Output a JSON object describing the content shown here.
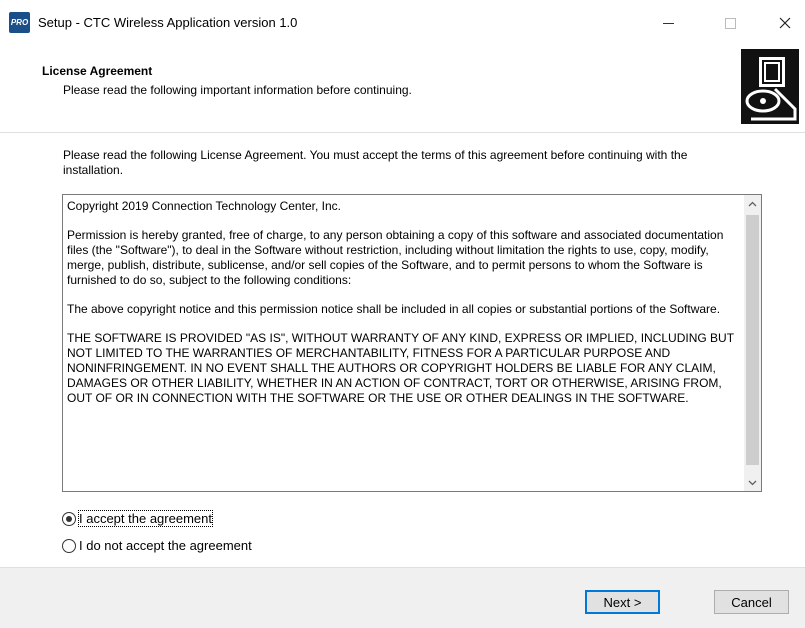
{
  "window": {
    "title": "Setup - CTC Wireless Application version 1.0",
    "icon": "setup-app-icon",
    "icon_text": "PRO",
    "controls": {
      "minimize": "—",
      "close": "✕"
    }
  },
  "header": {
    "title": "License Agreement",
    "subtitle": "Please read the following important information before continuing."
  },
  "instruction": "Please read the following License Agreement. You must accept the terms of this agreement before continuing with the installation.",
  "license": {
    "paragraphs": [
      "Copyright 2019 Connection Technology Center, Inc.",
      "Permission is hereby granted, free of charge, to any person obtaining a copy of this software and associated documentation files (the \"Software\"), to deal in the Software without restriction, including without limitation the rights to use, copy, modify, merge, publish, distribute, sublicense, and/or sell copies of the Software, and to permit persons to whom the Software is furnished to do so, subject to the following conditions:",
      "The above copyright notice and this permission notice shall be included in all copies or substantial portions of the Software.",
      "THE SOFTWARE IS PROVIDED \"AS IS\", WITHOUT WARRANTY OF ANY KIND, EXPRESS OR IMPLIED, INCLUDING BUT NOT LIMITED TO THE WARRANTIES OF MERCHANTABILITY, FITNESS FOR A PARTICULAR PURPOSE AND NONINFRINGEMENT. IN NO EVENT SHALL THE AUTHORS OR COPYRIGHT HOLDERS BE LIABLE FOR ANY CLAIM, DAMAGES OR OTHER LIABILITY, WHETHER IN AN ACTION OF CONTRACT, TORT OR OTHERWISE, ARISING FROM, OUT OF OR IN CONNECTION WITH THE SOFTWARE OR THE USE OR OTHER DEALINGS IN THE SOFTWARE."
    ]
  },
  "options": {
    "accept": {
      "label": "I accept the agreement",
      "selected": true
    },
    "decline": {
      "label": "I do not accept the agreement",
      "selected": false
    }
  },
  "buttons": {
    "next": "Next >",
    "cancel": "Cancel"
  },
  "colors": {
    "accent": "#0078d7",
    "footer_bg": "#f0f0f0"
  }
}
